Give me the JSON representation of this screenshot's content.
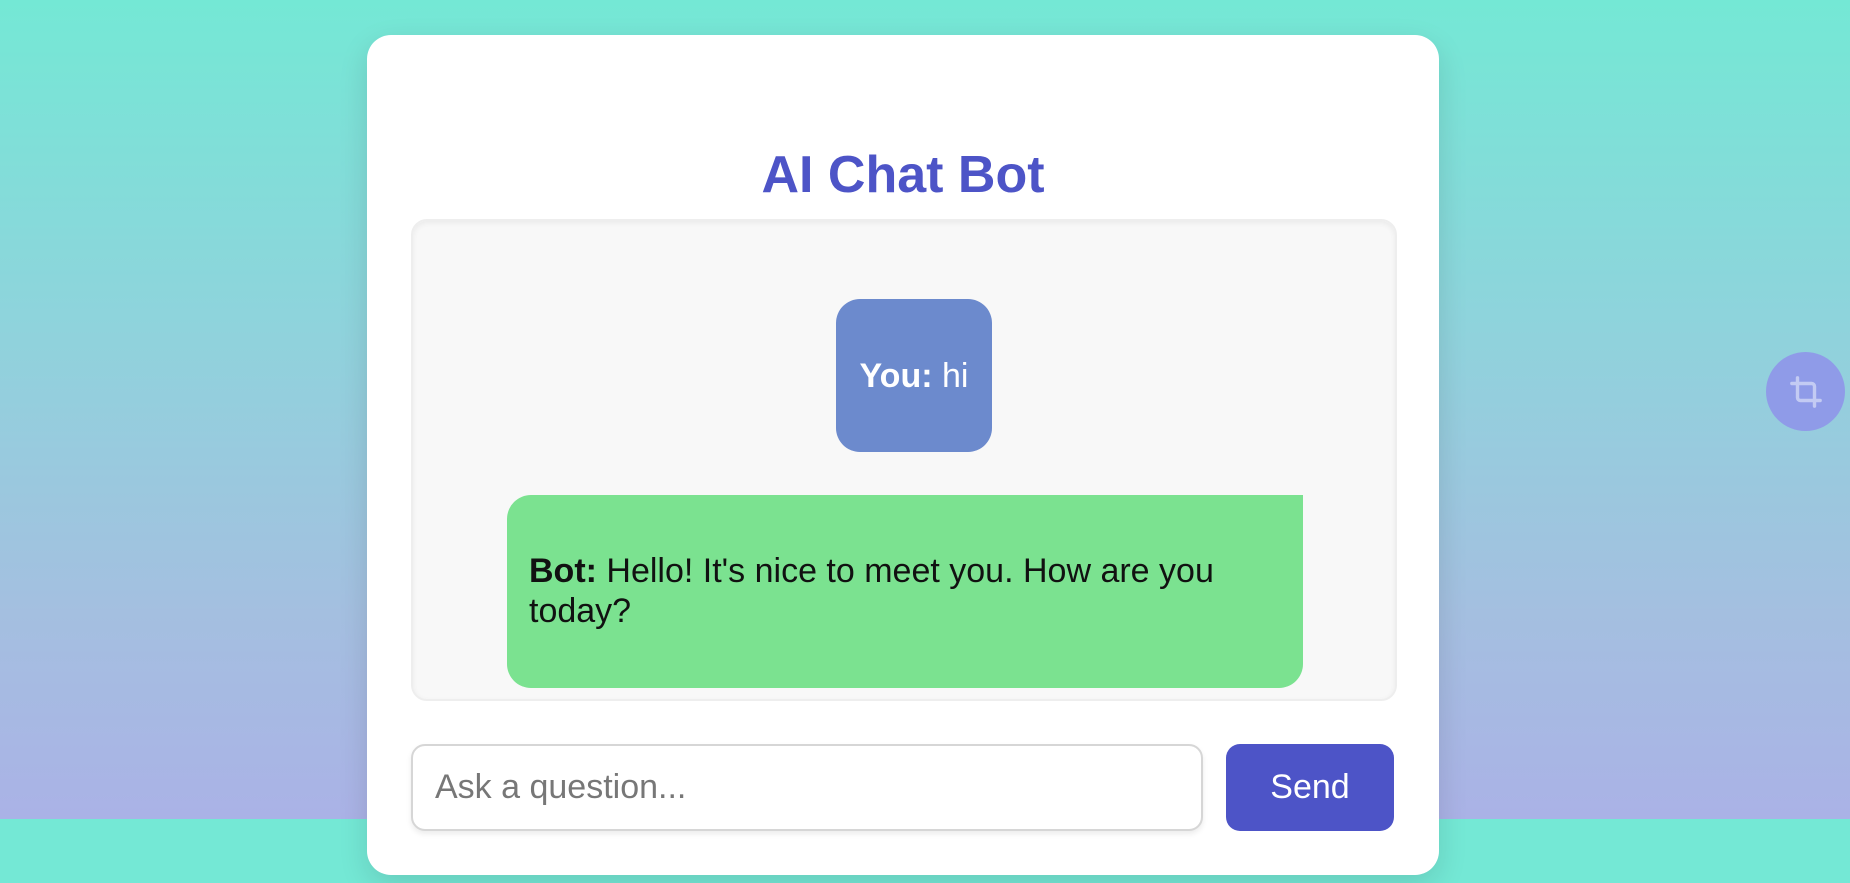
{
  "app": {
    "title": "AI Chat Bot"
  },
  "chat": {
    "messages": [
      {
        "role": "user",
        "sender_label": "You:",
        "text": " hi"
      },
      {
        "role": "bot",
        "sender_label": "Bot:",
        "text": " Hello! It's nice to meet you. How are you today?"
      }
    ]
  },
  "input": {
    "placeholder": "Ask a question...",
    "value": ""
  },
  "actions": {
    "send_label": "Send"
  },
  "floating_button": {
    "icon": "crop-icon"
  },
  "colors": {
    "accent": "#4d54c7",
    "user_bubble": "#6c8acd",
    "bot_bubble": "#7be290",
    "background_top": "#74e8d5",
    "background_bottom": "#aab2e6"
  }
}
